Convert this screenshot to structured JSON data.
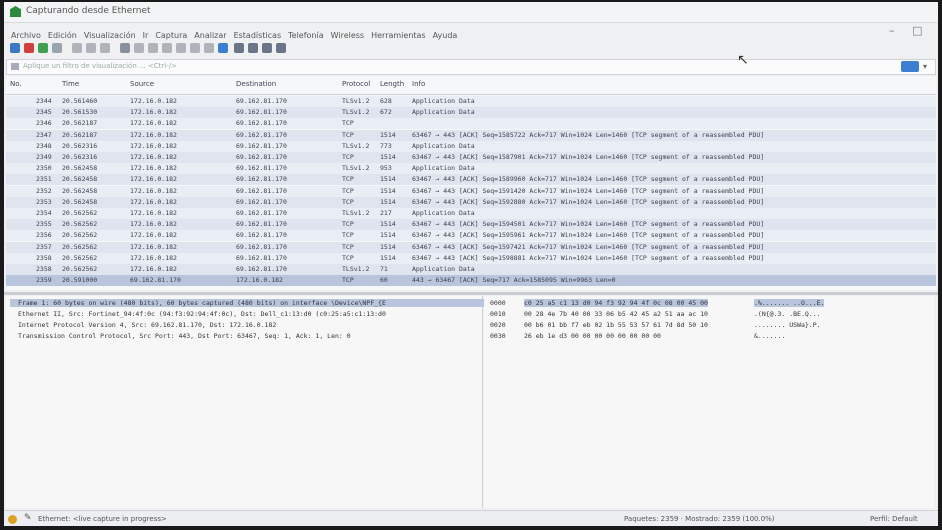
{
  "window": {
    "title": "Capturando desde Ethernet"
  },
  "menu": [
    "Archivo",
    "Edición",
    "Visualización",
    "Ir",
    "Captura",
    "Analizar",
    "Estadísticas",
    "Telefonía",
    "Wireless",
    "Herramientas",
    "Ayuda"
  ],
  "filter": {
    "placeholder": "Aplique un filtro de visualización ... <Ctrl-/>"
  },
  "columns": [
    "No.",
    "Time",
    "Source",
    "Destination",
    "Protocol",
    "Length",
    "Info"
  ],
  "packets": [
    {
      "no": "2344",
      "time": "20.561460",
      "src": "172.16.0.182",
      "dst": "69.162.81.170",
      "proto": "TLSv1.2",
      "len": "628",
      "info": "Application Data"
    },
    {
      "no": "2345",
      "time": "20.561530",
      "src": "172.16.0.182",
      "dst": "69.162.81.170",
      "proto": "TLSv1.2",
      "len": "672",
      "info": "Application Data"
    },
    {
      "no": "2346",
      "time": "20.562187",
      "src": "172.16.0.182",
      "dst": "69.162.81.170",
      "proto": "TCP",
      "len": "",
      "info": ""
    },
    {
      "no": "2347",
      "time": "20.562187",
      "src": "172.16.0.182",
      "dst": "69.162.81.170",
      "proto": "TCP",
      "len": "1514",
      "info": "63467 → 443 [ACK] Seq=1585722 Ack=717 Win=1024 Len=1460 [TCP segment of a reassembled PDU]"
    },
    {
      "no": "2348",
      "time": "20.562316",
      "src": "172.16.0.182",
      "dst": "69.162.81.170",
      "proto": "TLSv1.2",
      "len": "773",
      "info": "Application Data"
    },
    {
      "no": "2349",
      "time": "20.562316",
      "src": "172.16.0.182",
      "dst": "69.162.81.170",
      "proto": "TCP",
      "len": "1514",
      "info": "63467 → 443 [ACK] Seq=1587901 Ack=717 Win=1024 Len=1460 [TCP segment of a reassembled PDU]"
    },
    {
      "no": "2350",
      "time": "20.562458",
      "src": "172.16.0.182",
      "dst": "69.162.81.170",
      "proto": "TLSv1.2",
      "len": "953",
      "info": "Application Data"
    },
    {
      "no": "2351",
      "time": "20.562458",
      "src": "172.16.0.182",
      "dst": "69.162.81.170",
      "proto": "TCP",
      "len": "1514",
      "info": "63467 → 443 [ACK] Seq=1589960 Ack=717 Win=1024 Len=1460 [TCP segment of a reassembled PDU]"
    },
    {
      "no": "2352",
      "time": "20.562458",
      "src": "172.16.0.182",
      "dst": "69.162.81.170",
      "proto": "TCP",
      "len": "1514",
      "info": "63467 → 443 [ACK] Seq=1591420 Ack=717 Win=1024 Len=1460 [TCP segment of a reassembled PDU]"
    },
    {
      "no": "2353",
      "time": "20.562458",
      "src": "172.16.0.182",
      "dst": "69.162.81.170",
      "proto": "TCP",
      "len": "1514",
      "info": "63467 → 443 [ACK] Seq=1592880 Ack=717 Win=1024 Len=1460 [TCP segment of a reassembled PDU]"
    },
    {
      "no": "2354",
      "time": "20.562562",
      "src": "172.16.0.182",
      "dst": "69.162.81.170",
      "proto": "TLSv1.2",
      "len": "217",
      "info": "Application Data"
    },
    {
      "no": "2355",
      "time": "20.562562",
      "src": "172.16.0.182",
      "dst": "69.162.81.170",
      "proto": "TCP",
      "len": "1514",
      "info": "63467 → 443 [ACK] Seq=1594501 Ack=717 Win=1024 Len=1460 [TCP segment of a reassembled PDU]"
    },
    {
      "no": "2356",
      "time": "20.562562",
      "src": "172.16.0.182",
      "dst": "69.162.81.170",
      "proto": "TCP",
      "len": "1514",
      "info": "63467 → 443 [ACK] Seq=1595961 Ack=717 Win=1024 Len=1460 [TCP segment of a reassembled PDU]"
    },
    {
      "no": "2357",
      "time": "20.562562",
      "src": "172.16.0.182",
      "dst": "69.162.81.170",
      "proto": "TCP",
      "len": "1514",
      "info": "63467 → 443 [ACK] Seq=1597421 Ack=717 Win=1024 Len=1460 [TCP segment of a reassembled PDU]"
    },
    {
      "no": "2358",
      "time": "20.562562",
      "src": "172.16.0.182",
      "dst": "69.162.81.170",
      "proto": "TCP",
      "len": "1514",
      "info": "63467 → 443 [ACK] Seq=1598881 Ack=717 Win=1024 Len=1460 [TCP segment of a reassembled PDU]"
    },
    {
      "no": "2358",
      "time": "20.562562",
      "src": "172.16.0.182",
      "dst": "69.162.81.170",
      "proto": "TLSv1.2",
      "len": "71",
      "info": "Application Data"
    },
    {
      "no": "2359",
      "time": "20.591000",
      "src": "69.162.81.170",
      "dst": "172.16.0.182",
      "proto": "TCP",
      "len": "60",
      "info": "443 → 63467 [ACK] Seq=717 Ack=1585095 Win=9963 Len=0"
    }
  ],
  "details": [
    "Frame 1: 60 bytes on wire (480 bits), 60 bytes captured (480 bits) on interface \\Device\\NPF_{E",
    "Ethernet II, Src: Fortinet_94:4f:0c (94:f3:92:94:4f:0c), Dst: Dell_c1:13:d0 (c0:25:a5:c1:13:d0",
    "Internet Protocol Version 4, Src: 69.162.81.170, Dst: 172.16.0.182",
    "Transmission Control Protocol, Src Port: 443, Dst Port: 63467, Seq: 1, Ack: 1, Len: 0"
  ],
  "hex": [
    {
      "off": "0000",
      "hex": "c0 25 a5 c1 13 d0 94 f3  92 94 4f 0c 08 00 45 00",
      "ascii": ".%....... ..O...E."
    },
    {
      "off": "0010",
      "hex": "00 28 4e 7b 40 00 33 06  b5 42 45 a2 51 aa ac 10",
      "ascii": ".(N{@.3. .BE.Q..."
    },
    {
      "off": "0020",
      "hex": "00 b6 01 bb f7 eb 02 1b  55 53 57 61 7d 8d 50 10",
      "ascii": "........ USWa}.P."
    },
    {
      "off": "0030",
      "hex": "26 eb 1e d3 00 00 00 00  00 00 00 00",
      "ascii": "&......."
    }
  ],
  "status": {
    "capture": "Ethernet: <live capture in progress>",
    "counts": "Paquetes: 2359 · Mostrado: 2359 (100.0%)",
    "profile": "Perfil: Default"
  }
}
